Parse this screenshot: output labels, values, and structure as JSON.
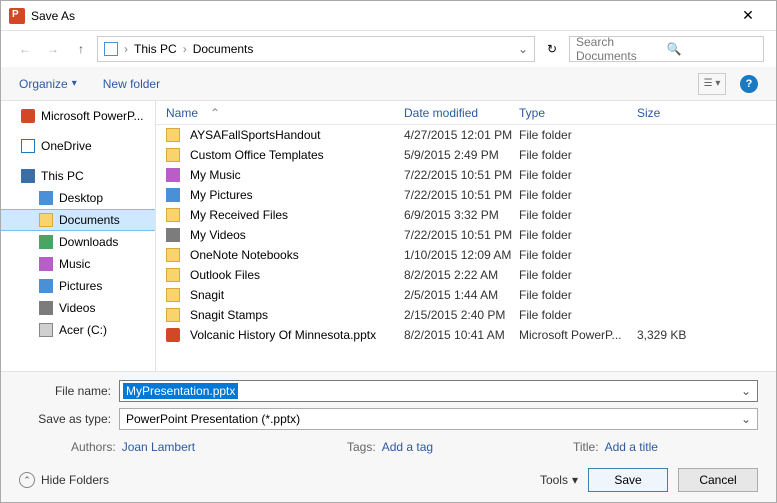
{
  "window": {
    "title": "Save As"
  },
  "nav": {
    "breadcrumb": {
      "pc": "This PC",
      "folder": "Documents"
    },
    "search_placeholder": "Search Documents"
  },
  "toolbar": {
    "organize": "Organize",
    "new_folder": "New folder"
  },
  "tree": {
    "items": [
      {
        "label": "Microsoft PowerP...",
        "icon": "pp",
        "lvl": 1
      },
      {
        "label": "OneDrive",
        "icon": "od",
        "lvl": 1
      },
      {
        "label": "This PC",
        "icon": "pc",
        "lvl": 1
      },
      {
        "label": "Desktop",
        "icon": "desk",
        "lvl": 2
      },
      {
        "label": "Documents",
        "icon": "folder",
        "lvl": 2,
        "selected": true
      },
      {
        "label": "Downloads",
        "icon": "dl",
        "lvl": 2
      },
      {
        "label": "Music",
        "icon": "music",
        "lvl": 2
      },
      {
        "label": "Pictures",
        "icon": "pic",
        "lvl": 2
      },
      {
        "label": "Videos",
        "icon": "vid",
        "lvl": 2
      },
      {
        "label": "Acer (C:)",
        "icon": "drive",
        "lvl": 2
      }
    ]
  },
  "list": {
    "headers": {
      "name": "Name",
      "date": "Date modified",
      "type": "Type",
      "size": "Size"
    },
    "rows": [
      {
        "name": "AYSAFallSportsHandout",
        "date": "4/27/2015 12:01 PM",
        "type": "File folder",
        "size": "",
        "icon": "folder"
      },
      {
        "name": "Custom Office Templates",
        "date": "5/9/2015 2:49 PM",
        "type": "File folder",
        "size": "",
        "icon": "folder"
      },
      {
        "name": "My Music",
        "date": "7/22/2015 10:51 PM",
        "type": "File folder",
        "size": "",
        "icon": "music"
      },
      {
        "name": "My Pictures",
        "date": "7/22/2015 10:51 PM",
        "type": "File folder",
        "size": "",
        "icon": "pic"
      },
      {
        "name": "My Received Files",
        "date": "6/9/2015 3:32 PM",
        "type": "File folder",
        "size": "",
        "icon": "folder"
      },
      {
        "name": "My Videos",
        "date": "7/22/2015 10:51 PM",
        "type": "File folder",
        "size": "",
        "icon": "vid"
      },
      {
        "name": "OneNote Notebooks",
        "date": "1/10/2015 12:09 AM",
        "type": "File folder",
        "size": "",
        "icon": "folder"
      },
      {
        "name": "Outlook Files",
        "date": "8/2/2015 2:22 AM",
        "type": "File folder",
        "size": "",
        "icon": "folder"
      },
      {
        "name": "Snagit",
        "date": "2/5/2015 1:44 AM",
        "type": "File folder",
        "size": "",
        "icon": "folder"
      },
      {
        "name": "Snagit Stamps",
        "date": "2/15/2015 2:40 PM",
        "type": "File folder",
        "size": "",
        "icon": "folder"
      },
      {
        "name": "Volcanic History Of Minnesota.pptx",
        "date": "8/2/2015 10:41 AM",
        "type": "Microsoft PowerP...",
        "size": "3,329 KB",
        "icon": "file"
      }
    ]
  },
  "fields": {
    "filename_label": "File name:",
    "filename_value": "MyPresentation.pptx",
    "saveas_label": "Save as type:",
    "saveas_value": "PowerPoint Presentation (*.pptx)"
  },
  "meta": {
    "authors_label": "Authors:",
    "authors_value": "Joan Lambert",
    "tags_label": "Tags:",
    "tags_value": "Add a tag",
    "title_label": "Title:",
    "title_value": "Add a title"
  },
  "footer": {
    "hide_folders": "Hide Folders",
    "tools": "Tools",
    "save": "Save",
    "cancel": "Cancel"
  }
}
